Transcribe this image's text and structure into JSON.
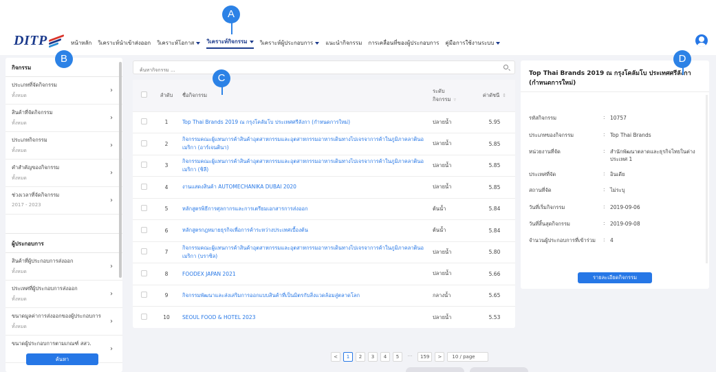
{
  "header": {
    "logo": "DITP",
    "nav": [
      {
        "label": "หน้าหลัก",
        "dropdown": false,
        "active": false
      },
      {
        "label": "วิเคราะห์นำเข้าส่งออก",
        "dropdown": false,
        "active": false
      },
      {
        "label": "วิเคราะห์โอกาส",
        "dropdown": true,
        "active": false
      },
      {
        "label": "วิเคราะห์กิจกรรม",
        "dropdown": true,
        "active": true
      },
      {
        "label": "วิเคราะห์ผู้ประกอบการ",
        "dropdown": true,
        "active": false
      },
      {
        "label": "แนะนำกิจกรรม",
        "dropdown": false,
        "active": false
      },
      {
        "label": "การเคลื่อนที่ของผู้ประกอบการ",
        "dropdown": false,
        "active": false
      },
      {
        "label": "คู่มือการใช้งานระบบ",
        "dropdown": true,
        "active": false
      }
    ],
    "avatar_icon": "user-icon"
  },
  "callouts": {
    "a": "A",
    "b": "B",
    "c": "C",
    "d": "D"
  },
  "sidebar": {
    "section1": "กิจกรรม",
    "items1": [
      {
        "label": "ประเภทที่จัดกิจกรรม",
        "value": "ทั้งหมด"
      },
      {
        "label": "สินค้าที่จัดกิจกรรม",
        "value": "ทั้งหมด"
      },
      {
        "label": "ประเภทกิจกรรม",
        "value": "ทั้งหมด"
      },
      {
        "label": "คำสำคัญของกิจกรรม",
        "value": "ทั้งหมด"
      },
      {
        "label": "ช่วงเวลาที่จัดกิจกรรม",
        "value": "2017 - 2023"
      }
    ],
    "section2": "ผู้ประกอบการ",
    "items2": [
      {
        "label": "สินค้าที่ผู้ประกอบการส่งออก",
        "value": "ทั้งหมด"
      },
      {
        "label": "ประเทศที่ผู้ประกอบการส่งออก",
        "value": "ทั้งหมด"
      },
      {
        "label": "ขนาดมูลค่าการส่งออกของผู้ประกอบการ",
        "value": "ทั้งหมด"
      },
      {
        "label": "ขนาดผู้ประกอบการตามเกณฑ์ สสว.",
        "value": ""
      }
    ],
    "search_button": "ค้นหา"
  },
  "main": {
    "search_placeholder": "ค้นหากิจกรรม ...",
    "columns": {
      "no": "ลำดับ",
      "name": "ชื่อกิจกรรม",
      "level": "ระดับ กิจกรรม",
      "score": "ค่าดัชนี"
    },
    "rows": [
      {
        "no": "1",
        "name": "Top Thai Brands 2019 ณ กรุงโคลัมโบ ประเทศศรีลังกา (กำหนดการใหม่)",
        "level": "ปลายน้ำ",
        "score": "5.95"
      },
      {
        "no": "2",
        "name": "กิจกรรมคณะผู้แทนการค้าสินค้าอุตสาหกรรมและอุตสาหกรรมอาหารเดินทางไปเจรจาการค้าในภูมิภาคลาตินอเมริกา (อาร์เจนตินา)",
        "level": "ปลายน้ำ",
        "score": "5.85"
      },
      {
        "no": "3",
        "name": "กิจกรรมคณะผู้แทนการค้าสินค้าอุตสาหกรรมและอุตสาหกรรมอาหารเดินทางไปเจรจาการค้าในภูมิภาคลาตินอเมริกา (ชิลี)",
        "level": "ปลายน้ำ",
        "score": "5.85"
      },
      {
        "no": "4",
        "name": "งานแสดงสินค้า AUTOMECHANIKA DUBAI 2020",
        "level": "ปลายน้ำ",
        "score": "5.85"
      },
      {
        "no": "5",
        "name": "หลักสูตรพิธีการศุลกากรและการเตรียมเอกสารการส่งออก",
        "level": "ต้นน้ำ",
        "score": "5.84"
      },
      {
        "no": "6",
        "name": "หลักสูตรกฎหมายธุรกิจเพื่อการค้าระหว่างประเทศเบื้องต้น",
        "level": "ต้นน้ำ",
        "score": "5.84"
      },
      {
        "no": "7",
        "name": "กิจกรรมคณะผู้แทนการค้าสินค้าอุตสาหกรรมและอุตสาหกรรมอาหารเดินทางไปเจรจาการค้าในภูมิภาคลาตินอเมริกา (บราซิล)",
        "level": "ปลายน้ำ",
        "score": "5.80"
      },
      {
        "no": "8",
        "name": "FOODEX JAPAN 2021",
        "level": "ปลายน้ำ",
        "score": "5.66"
      },
      {
        "no": "9",
        "name": "กิจกรรมพัฒนาและส่งเสริมการออกแบบสินค้าที่เป็นมิตรกับสิ่งแวดล้อมสู่ตลาดโลก",
        "level": "กลางน้ำ",
        "score": "5.65"
      },
      {
        "no": "10",
        "name": "SEOUL FOOD & HOTEL 2023",
        "level": "ปลายน้ำ",
        "score": "5.53"
      }
    ],
    "pagination": {
      "prev": "<",
      "pages": [
        "1",
        "2",
        "3",
        "4",
        "5"
      ],
      "ellipsis": "···",
      "last": "159",
      "next": ">",
      "per_page": "10 / page"
    }
  },
  "detail": {
    "title": "Top Thai Brands 2019 ณ กรุงโคลัมโบ ประเทศศรีลังกา (กำหนดการใหม่)",
    "fields": [
      {
        "key": "รหัสกิจกรรม",
        "value": "10757"
      },
      {
        "key": "ประเภทของกิจกรรม",
        "value": "Top Thai Brands"
      },
      {
        "key": "หน่วยงานที่จัด",
        "value": "สำนักพัฒนาตลาดและธุรกิจไทยในต่างประเทศ 1"
      },
      {
        "key": "ประเทศที่จัด",
        "value": "อินเดีย"
      },
      {
        "key": "สถานที่จัด",
        "value": "ไม่ระบุ"
      },
      {
        "key": "วันที่เริ่มกิจกรรม",
        "value": "2019-09-06"
      },
      {
        "key": "วันที่สิ้นสุดกิจกรรม",
        "value": "2019-09-08"
      },
      {
        "key": "จำนวนผู้ประกอบการที่เข้าร่วม",
        "value": "4"
      }
    ],
    "button": "รายละเอียดกิจกรรม"
  }
}
